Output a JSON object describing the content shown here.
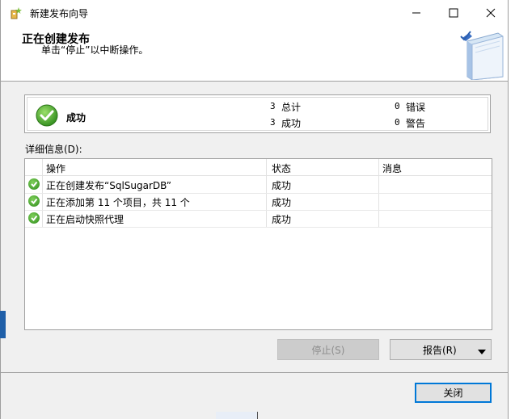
{
  "window": {
    "title": "新建发布向导",
    "minimize_label": "—",
    "maximize_label": "☐",
    "close_label": "✕"
  },
  "header": {
    "title": "正在创建发布",
    "subtitle": "单击“停止”以中断操作。"
  },
  "summary": {
    "status": "成功",
    "total_count": "3",
    "total_label": "总计",
    "success_count": "3",
    "success_label": "成功",
    "error_count": "0",
    "error_label": "错误",
    "warning_count": "0",
    "warning_label": "警告"
  },
  "details": {
    "label": "详细信息(D):",
    "columns": [
      "操作",
      "状态",
      "消息"
    ],
    "rows": [
      {
        "action": "正在创建发布“SqlSugarDB”",
        "status": "成功",
        "message": ""
      },
      {
        "action": "正在添加第 11 个项目，共 11 个",
        "status": "成功",
        "message": ""
      },
      {
        "action": "正在启动快照代理",
        "status": "成功",
        "message": ""
      }
    ]
  },
  "buttons": {
    "stop_label": "停止(S)",
    "report_label": "报告(R)",
    "close_label": "关闭"
  },
  "colors": {
    "accent": "#0078d7",
    "success": "#2e8b1c"
  }
}
